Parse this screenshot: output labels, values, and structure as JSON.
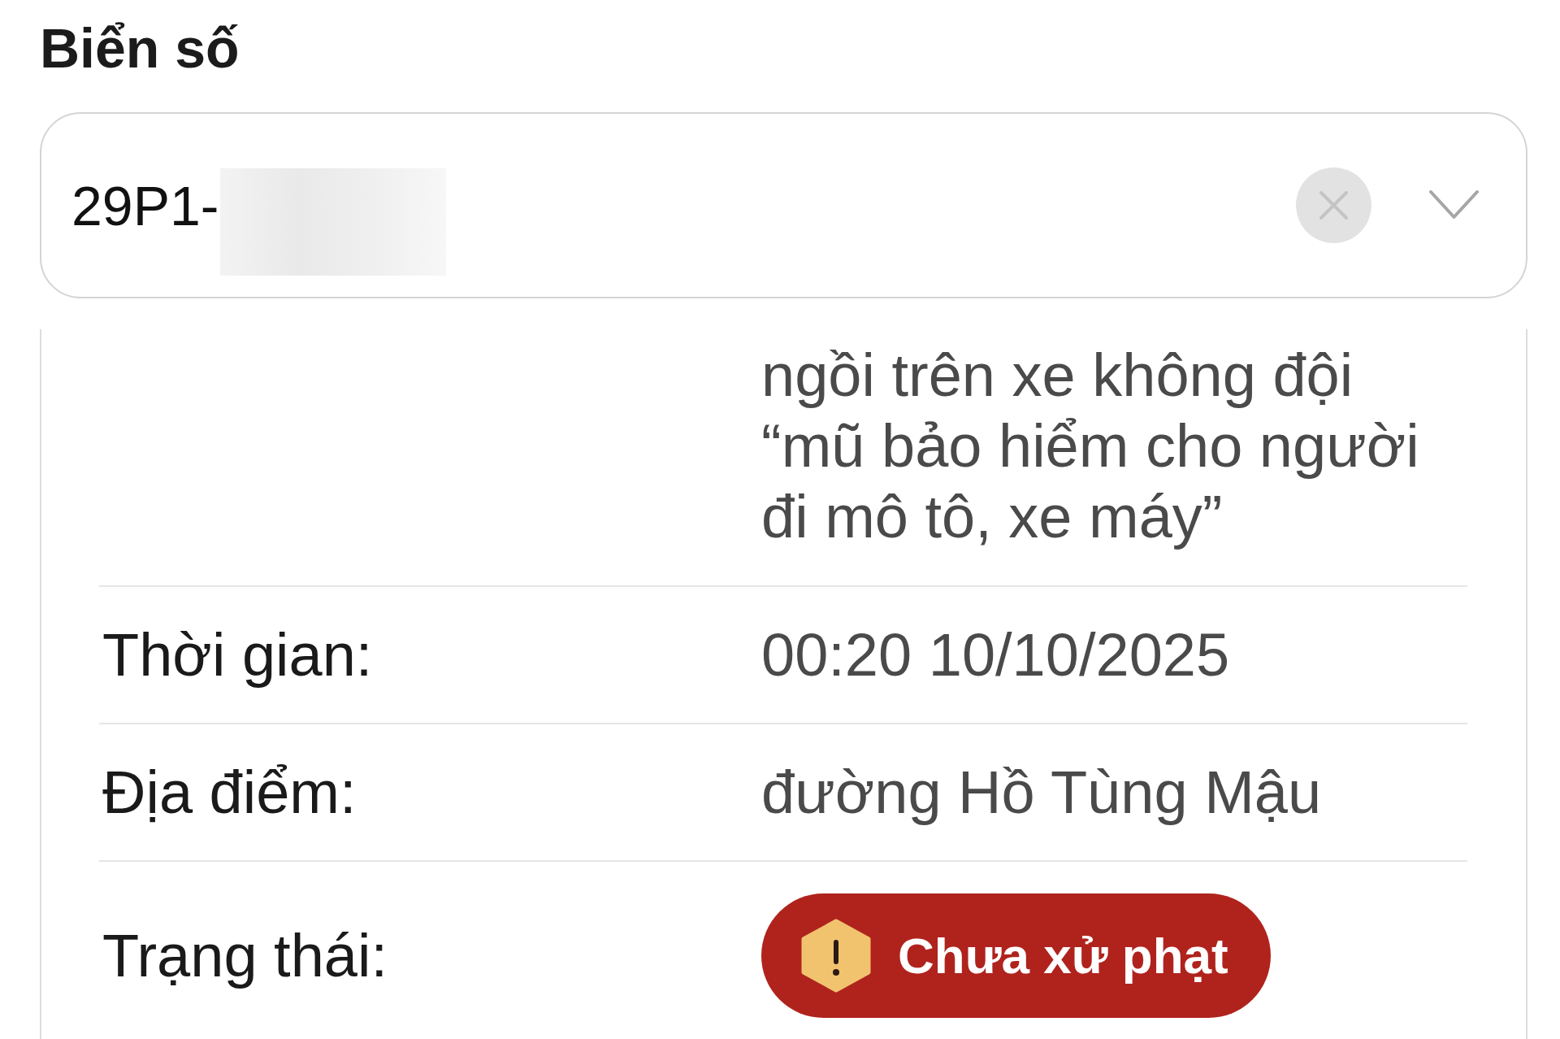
{
  "plate_field": {
    "label": "Biển số",
    "value": "29P1-",
    "masked": true
  },
  "details": [
    {
      "kind": "text",
      "value": "ngồi trên xe không đội “mũ bảo hiểm cho người đi mô tô, xe máy”"
    },
    {
      "kind": "text",
      "label": "Thời gian:",
      "value": "00:20 10/10/2025"
    },
    {
      "kind": "text",
      "label": "Địa điểm:",
      "value": "đường Hồ Tùng Mậu"
    },
    {
      "kind": "badge",
      "label": "Trạng thái:",
      "badge": {
        "text": "Chưa xử phạt",
        "kind": "warning"
      }
    }
  ]
}
